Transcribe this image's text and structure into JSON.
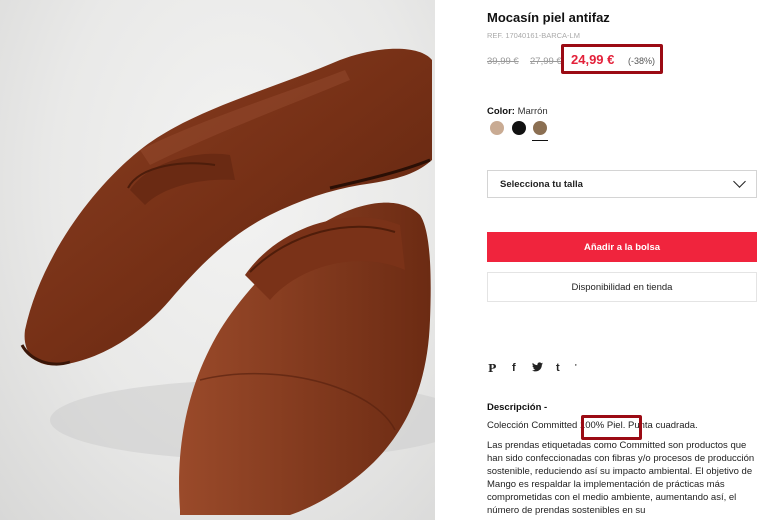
{
  "product": {
    "title": "Mocasín piel antifaz",
    "ref": "REF. 17040161-BARCA-LM",
    "old_price_1": "39,99 €",
    "old_price_2": "27,99 €",
    "price": "24,99 €",
    "discount": "(-38%)"
  },
  "color": {
    "label": "Color:",
    "value": "Marrón",
    "swatches": [
      {
        "name": "beige",
        "hex": "#c9ab93"
      },
      {
        "name": "black",
        "hex": "#111111"
      },
      {
        "name": "brown",
        "hex": "#8b6f52",
        "selected": true
      }
    ]
  },
  "size_select": {
    "label": "Selecciona tu talla"
  },
  "buttons": {
    "add": "Añadir a la bolsa",
    "availability": "Disponibilidad en tienda"
  },
  "social": {
    "pinterest": "P",
    "facebook": "f",
    "twitter": "t",
    "tumblr": "t",
    "more": "'"
  },
  "description": {
    "heading": "Descripción -",
    "line1_pre": "Colección Committed ",
    "line1_hl": "100% Piel",
    "line1_post": ". Punta cuadrada.",
    "body": "Las prendas etiquetadas como Committed son productos que han sido confeccionadas con fibras y/o procesos de producción sostenible, reduciendo así su impacto ambiental. El objetivo de Mango es respaldar la implementación de prácticas más comprometidas con el medio ambiente, aumentando así, el número de prendas sostenibles en su"
  },
  "colors": {
    "accent": "#f0243d",
    "highlight_box": "#9b0b14",
    "price": "#e3213a"
  }
}
